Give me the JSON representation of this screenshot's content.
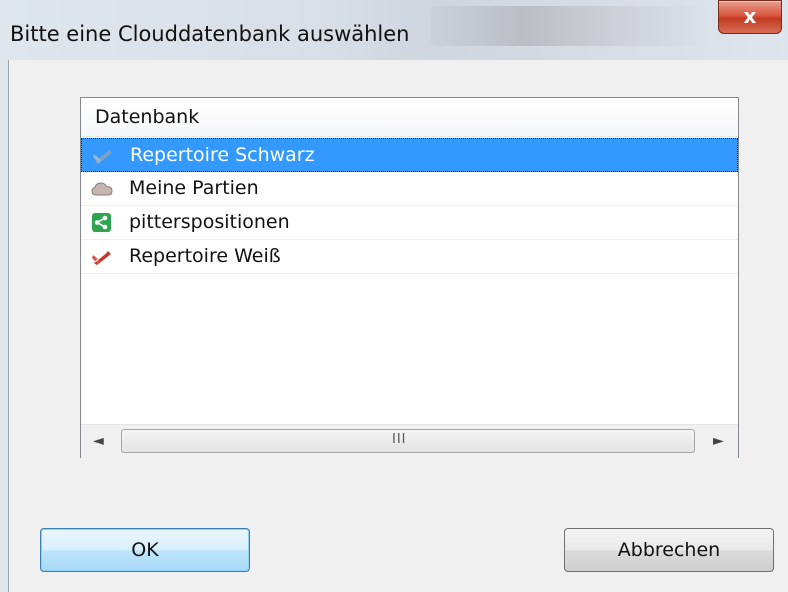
{
  "window": {
    "title": "Bitte eine Clouddatenbank auswählen",
    "close_label": "x"
  },
  "list": {
    "column_header": "Datenbank",
    "items": [
      {
        "label": "Repertoire Schwarz",
        "icon": "repertoire-black-icon",
        "selected": true
      },
      {
        "label": "Meine Partien",
        "icon": "cloud-icon",
        "selected": false
      },
      {
        "label": "pitterspositionen",
        "icon": "share-icon",
        "selected": false
      },
      {
        "label": "Repertoire Weiß",
        "icon": "repertoire-white-icon",
        "selected": false
      }
    ],
    "scroll_grip": "III"
  },
  "buttons": {
    "ok_label": "OK",
    "cancel_label": "Abbrechen"
  },
  "colors": {
    "selection": "#3399ff",
    "close_button": "#c94a32",
    "share_icon": "#2ea44f"
  }
}
